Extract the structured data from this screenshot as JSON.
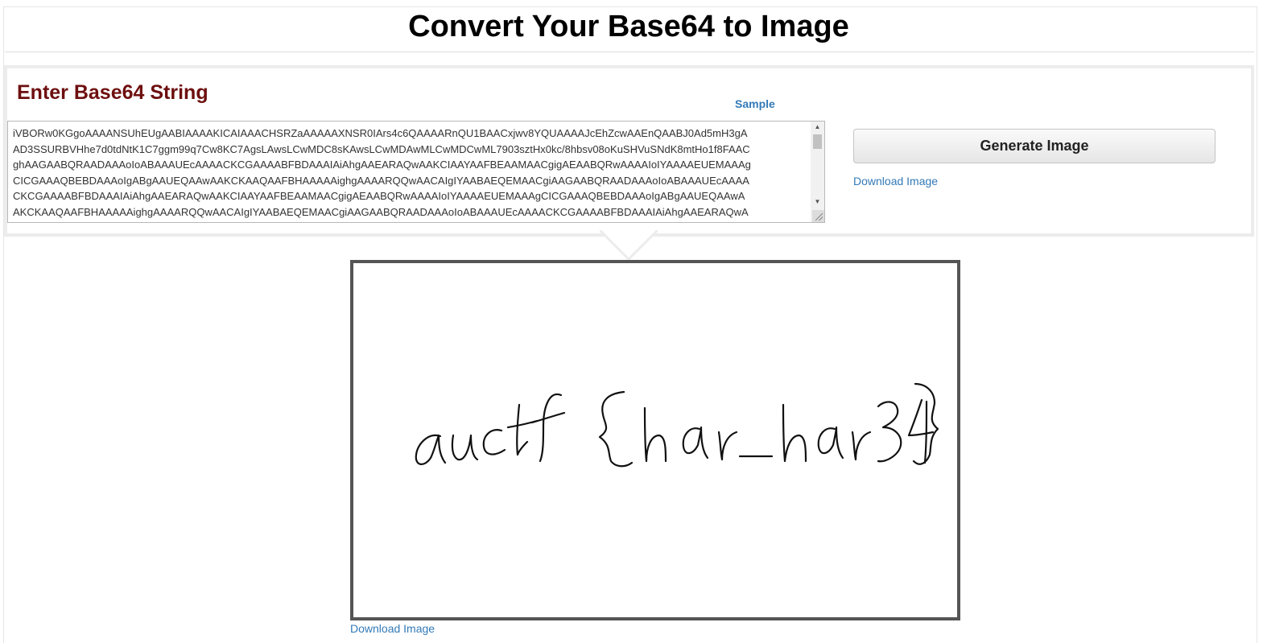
{
  "page": {
    "title": "Convert Your Base64 to Image"
  },
  "input_panel": {
    "heading": "Enter Base64 String",
    "sample_link": "Sample",
    "textarea_lines": [
      "iVBORw0KGgoAAAANSUhEUgAABIAAAAKICAIAAACHSRZaAAAAAXNSR0IArs4c6QAAAARnQU1BAACxjwv8YQUAAAAJcEhZcwAAEnQAABJ0Ad5mH3gA",
      "AD3SSURBVHhe7d0tdNtK1C7ggm99q7Cw8KC7AgsLAwsLCwMDC8sKAwsLCwMDAwMLCwMDCwML7903sztHx0kc/8hbsv08oKuSHVuSNdK8mtHo1f8FAAC",
      "ghAAGAABQRAADAAAoIoABAAAUEcAAAACKCGAAAABFBDAAAIAiAhgAAEARAQwAAKCIAAYAAFBEAAMAACgigAEAABQRwAAAAIoIYAAAAEUEMAAAg",
      "CICGAAAQBEBDAAAoIgABgAAUEQAAwAAKCKAAQAAFBHAAAAAighgAAAARQQwAACAIgIYAABAEQEMAACgiAAGAABQRAADAAAoIoABAAAUEcAAAA",
      "CKCGAAAABFBDAAAIAiAhgAAEARAQwAAKCIAAYAAFBEAAMAACgigAEAABQRwAAAAIoIYAAAAEUEMAAAgCICGAAAQBEBDAAAoIgABgAAUEQAAwA",
      "AKCKAAQAAFBHAAAAAighgAAAARQQwAACAIgIYAABAEQEMAACgiAAGAABQRAADAAAoIoABAAAUEcAAAACKCGAAAABFBDAAAIAiAhgAAEARAQwA"
    ]
  },
  "actions": {
    "generate_label": "Generate Image",
    "download_label_top": "Download Image",
    "download_label_bottom": "Download Image"
  },
  "output_image": {
    "handwritten_text": "auctf{har_har34}"
  }
}
